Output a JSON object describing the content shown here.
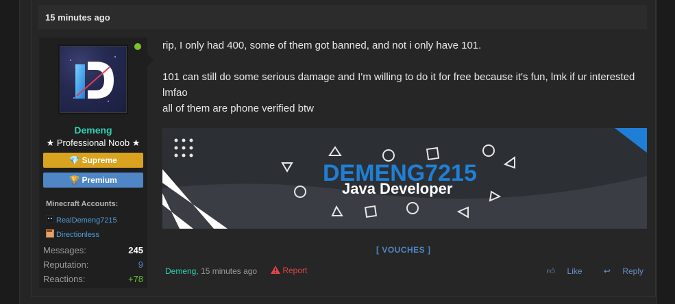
{
  "post": {
    "time": "15 minutes ago",
    "message_lines": [
      "rip, I only had 400, some of them got banned, and not i only have 101.",
      "101 can still do some serious damage and I'm willing to do it for free because it's fun, lmk if ur interested lmfao",
      "all of them are phone verified btw"
    ]
  },
  "user": {
    "name": "Demeng",
    "title": "★ Professional Noob ★",
    "banners": [
      "Supreme",
      "Premium"
    ],
    "minecraft_title": "Minecraft Accounts:",
    "minecraft_accounts": [
      "RealDemeng7215",
      "Directionless"
    ],
    "stats": [
      {
        "label": "Messages:",
        "value": "245",
        "color": "#ffffff"
      },
      {
        "label": "Reputation:",
        "value": "9",
        "color": "#4f86c6"
      },
      {
        "label": "Reactions:",
        "value": "+78",
        "color": "#6fbf3a"
      }
    ],
    "online_color": "#7ec12f"
  },
  "signature": {
    "line1": "DEMENG7215",
    "line2": "Java Developer"
  },
  "vouches_label": "[ VOUCHES ]",
  "footer": {
    "author": "Demeng,",
    "time": "15 minutes ago",
    "report": "Report",
    "like": "Like",
    "reply": "Reply"
  },
  "colors": {
    "accent_teal": "#2fd1b3",
    "link_blue": "#4f86c6",
    "supreme_gold": "#d9a31f",
    "report_red": "#e14545"
  }
}
